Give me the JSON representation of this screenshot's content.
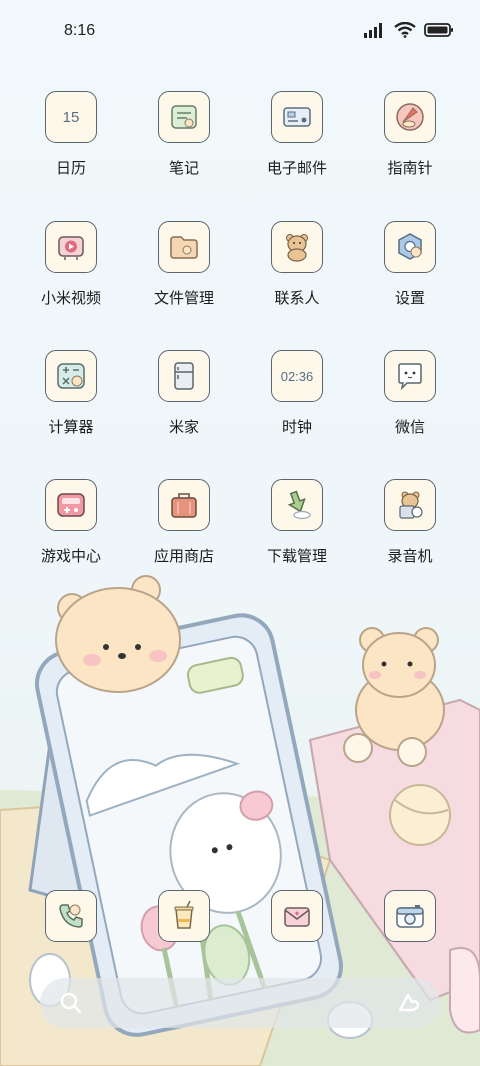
{
  "status_bar": {
    "time": "8:16"
  },
  "apps": [
    {
      "label": "日历",
      "icon": "calendar-icon",
      "icon_text": "15"
    },
    {
      "label": "笔记",
      "icon": "notes-icon"
    },
    {
      "label": "电子邮件",
      "icon": "email-icon"
    },
    {
      "label": "指南针",
      "icon": "compass-icon"
    },
    {
      "label": "小米视频",
      "icon": "video-icon"
    },
    {
      "label": "文件管理",
      "icon": "folder-icon"
    },
    {
      "label": "联系人",
      "icon": "contacts-icon"
    },
    {
      "label": "设置",
      "icon": "settings-icon"
    },
    {
      "label": "计算器",
      "icon": "calculator-icon"
    },
    {
      "label": "米家",
      "icon": "fridge-icon"
    },
    {
      "label": "时钟",
      "icon": "clock-icon",
      "icon_text": "02:36"
    },
    {
      "label": "微信",
      "icon": "chat-bubble-icon"
    },
    {
      "label": "游戏中心",
      "icon": "game-console-icon"
    },
    {
      "label": "应用商店",
      "icon": "shopping-bag-icon"
    },
    {
      "label": "下载管理",
      "icon": "download-arrow-icon"
    },
    {
      "label": "录音机",
      "icon": "recorder-icon"
    }
  ],
  "dock": [
    {
      "icon": "phone-icon"
    },
    {
      "icon": "drink-cup-icon"
    },
    {
      "icon": "message-envelope-icon"
    },
    {
      "icon": "camera-icon"
    }
  ],
  "search": {
    "icon": "search-icon",
    "assistant_icon": "assistant-icon"
  },
  "colors": {
    "icon_border": "#5a6570",
    "icon_background": "#fdf8ea",
    "label_text": "#1d1d1d"
  }
}
